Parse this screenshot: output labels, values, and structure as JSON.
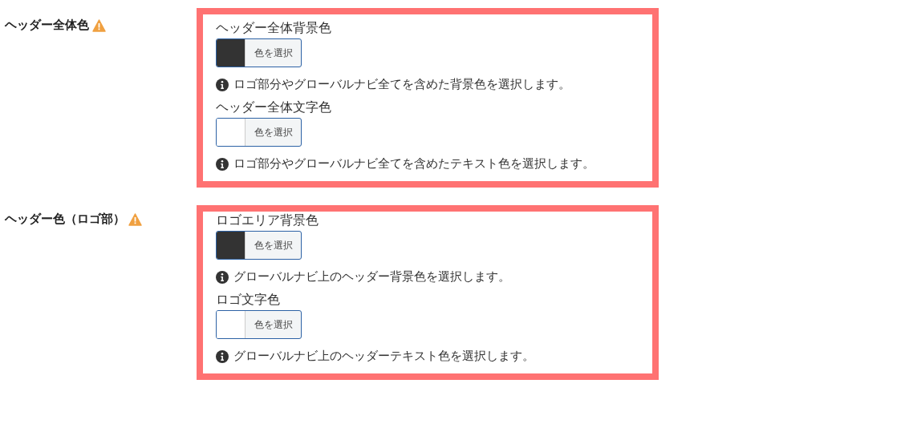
{
  "sections": [
    {
      "label": "ヘッダー全体色",
      "warning": true,
      "fields": [
        {
          "label": "ヘッダー全体背景色",
          "color": "#333333",
          "button": "色を選択",
          "help": "ロゴ部分やグローバルナビ全てを含めた背景色を選択します。"
        },
        {
          "label": "ヘッダー全体文字色",
          "color": "#ffffff",
          "button": "色を選択",
          "help": "ロゴ部分やグローバルナビ全てを含めたテキスト色を選択します。"
        }
      ]
    },
    {
      "label": "ヘッダー色（ロゴ部）",
      "warning": true,
      "fields": [
        {
          "label": "ロゴエリア背景色",
          "color": "#333333",
          "button": "色を選択",
          "help": "グローバルナビ上のヘッダー背景色を選択します。"
        },
        {
          "label": "ロゴ文字色",
          "color": "#ffffff",
          "button": "色を選択",
          "help": "グローバルナビ上のヘッダーテキスト色を選択します。"
        }
      ]
    }
  ]
}
